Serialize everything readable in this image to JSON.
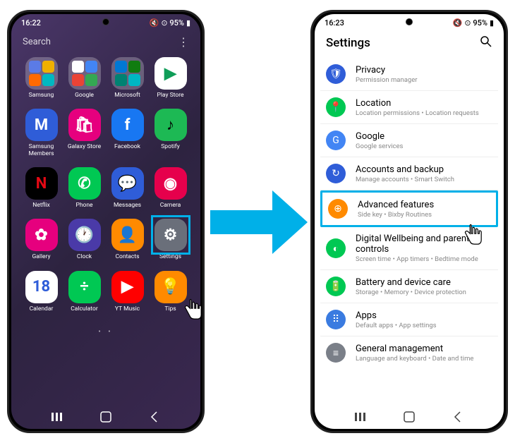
{
  "left": {
    "time": "16:22",
    "battery": "95%",
    "search": "Search",
    "rows": [
      [
        {
          "label": "Samsung",
          "type": "folder",
          "minis": [
            "#5b7be6",
            "#f0b000",
            "#ff6a00",
            "#00b8c0"
          ]
        },
        {
          "label": "Google",
          "type": "folder",
          "minis": [
            "#fff",
            "#4285f4",
            "#ea4335",
            "#34a853"
          ]
        },
        {
          "label": "Microsoft",
          "type": "folder",
          "minis": [
            "#0078d4",
            "#107c10",
            "#008272",
            "#00b7c3"
          ]
        },
        {
          "label": "Play Store",
          "type": "app",
          "bg": "#fff",
          "glyph": "▶",
          "glyphColor": "#0f9d58"
        }
      ],
      [
        {
          "label": "Samsung Members",
          "type": "app",
          "bg": "#2f5dd8",
          "glyph": "M",
          "glyphColor": "#fff"
        },
        {
          "label": "Galaxy Store",
          "type": "app",
          "bg": "#e6007e",
          "glyph": "🛍",
          "glyphColor": "#fff"
        },
        {
          "label": "Facebook",
          "type": "app",
          "bg": "#1877f2",
          "glyph": "f",
          "glyphColor": "#fff"
        },
        {
          "label": "Spotify",
          "type": "app",
          "bg": "#1db954",
          "glyph": "♪",
          "glyphColor": "#000"
        }
      ],
      [
        {
          "label": "Netflix",
          "type": "app",
          "bg": "#000",
          "glyph": "N",
          "glyphColor": "#e50914"
        },
        {
          "label": "Phone",
          "type": "app",
          "bg": "#00c853",
          "glyph": "✆",
          "glyphColor": "#fff"
        },
        {
          "label": "Messages",
          "type": "app",
          "bg": "#2f5dd8",
          "glyph": "💬",
          "glyphColor": "#fff"
        },
        {
          "label": "Camera",
          "type": "app",
          "bg": "#e6004c",
          "glyph": "◉",
          "glyphColor": "#fff"
        }
      ],
      [
        {
          "label": "Gallery",
          "type": "app",
          "bg": "#e6007e",
          "glyph": "✿",
          "glyphColor": "#fff"
        },
        {
          "label": "Clock",
          "type": "app",
          "bg": "#4a3aa8",
          "glyph": "🕐",
          "glyphColor": "#fff"
        },
        {
          "label": "Contacts",
          "type": "app",
          "bg": "#ff8a00",
          "glyph": "👤",
          "glyphColor": "#fff"
        },
        {
          "label": "Settings",
          "type": "app",
          "bg": "#6a6f7a",
          "glyph": "⚙",
          "glyphColor": "#fff",
          "highlight": true
        }
      ],
      [
        {
          "label": "Calendar",
          "type": "app",
          "bg": "#fff",
          "glyph": "18",
          "glyphColor": "#2f5dd8"
        },
        {
          "label": "Calculator",
          "type": "app",
          "bg": "#00c853",
          "glyph": "÷",
          "glyphColor": "#fff"
        },
        {
          "label": "YT Music",
          "type": "app",
          "bg": "#ff0000",
          "glyph": "▶",
          "glyphColor": "#fff"
        },
        {
          "label": "Tips",
          "type": "app",
          "bg": "#ff8a00",
          "glyph": "💡",
          "glyphColor": "#fff"
        }
      ]
    ]
  },
  "right": {
    "time": "16:23",
    "battery": "95%",
    "title": "Settings",
    "items": [
      {
        "icon": "🛡",
        "bg": "#2f5dd8",
        "title": "Privacy",
        "sub": "Permission manager"
      },
      {
        "icon": "📍",
        "bg": "#00c853",
        "title": "Location",
        "sub": "Location permissions  •  Location requests"
      },
      {
        "icon": "G",
        "bg": "#4285f4",
        "title": "Google",
        "sub": "Google services"
      },
      {
        "icon": "↻",
        "bg": "#2f5dd8",
        "title": "Accounts and backup",
        "sub": "Manage accounts  •  Smart Switch"
      },
      {
        "icon": "⊕",
        "bg": "#ff8a00",
        "title": "Advanced features",
        "sub": "Side key  •  Bixby Routines",
        "highlight": true
      },
      {
        "icon": "◐",
        "bg": "#00c853",
        "title": "Digital Wellbeing and parental controls",
        "sub": "Screen time  •  App timers  •  Bedtime mode"
      },
      {
        "icon": "🔋",
        "bg": "#00c853",
        "title": "Battery and device care",
        "sub": "Storage  •  Memory  •  Device protection"
      },
      {
        "icon": "⠿",
        "bg": "#3a7be0",
        "title": "Apps",
        "sub": "Default apps  •  App settings"
      },
      {
        "icon": "≡",
        "bg": "#7a7f88",
        "title": "General management",
        "sub": "Language and keyboard  •  Date and time"
      }
    ]
  }
}
